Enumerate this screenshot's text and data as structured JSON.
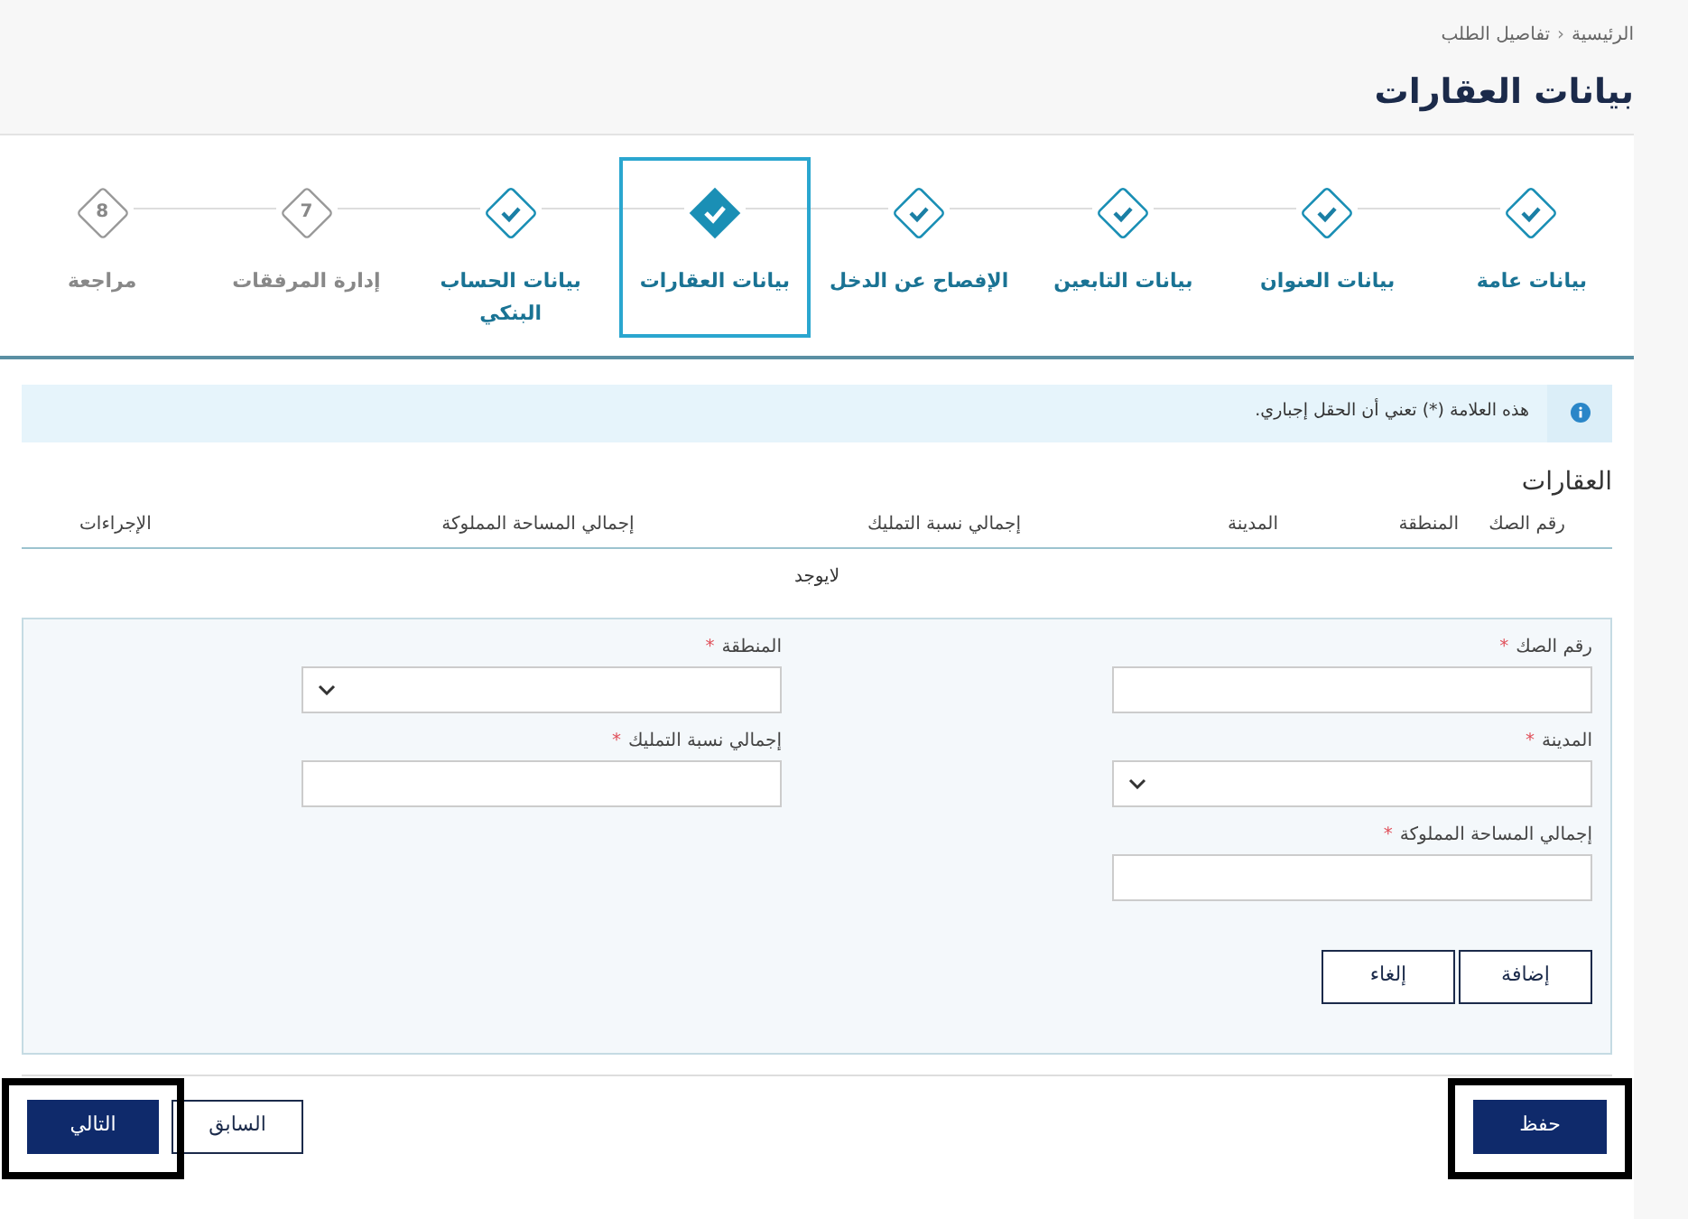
{
  "breadcrumb": [
    {
      "label": "الرئيسية"
    },
    {
      "label": "تفاصيل الطلب"
    }
  ],
  "breadcrumb_separator": "‹",
  "page_title": "بيانات العقارات",
  "steps": [
    {
      "label": "بيانات عامة",
      "kind": "done",
      "selected": false
    },
    {
      "label": "بيانات العنوان",
      "kind": "done",
      "selected": false
    },
    {
      "label": "بيانات التابعين",
      "kind": "done",
      "selected": false
    },
    {
      "label": "الإفصاح عن الدخل",
      "kind": "done",
      "selected": false
    },
    {
      "label": "بيانات العقارات",
      "kind": "current",
      "selected": true
    },
    {
      "label": "بيانات الحساب البنكي",
      "kind": "done",
      "selected": false
    },
    {
      "label": "إدارة المرفقات",
      "kind": "pending",
      "number": "7",
      "selected": false
    },
    {
      "label": "مراجعة",
      "kind": "pending",
      "number": "8",
      "selected": false
    }
  ],
  "notice": "هذه العلامة (*) تعني أن الحقل إجباري.",
  "section_title": "العقارات",
  "table": {
    "columns": [
      "رقم الصك",
      "المنطقة",
      "المدينة",
      "إجمالي نسبة التمليك",
      "إجمالي المساحة المملوكة",
      "الإجراءات"
    ],
    "empty_text": "لايوجد"
  },
  "form": {
    "fields": [
      {
        "label": "رقم الصك",
        "kind": "text",
        "required": true
      },
      {
        "label": "المنطقة",
        "kind": "select",
        "required": true
      },
      {
        "label": "المدينة",
        "kind": "select",
        "required": true
      },
      {
        "label": "إجمالي نسبة التمليك",
        "kind": "text",
        "required": true
      },
      {
        "label": "إجمالي المساحة المملوكة",
        "kind": "text",
        "required": true
      }
    ],
    "required_mark": "*",
    "buttons": [
      "إضافة",
      "إلغاء"
    ]
  },
  "footer": {
    "save": {
      "label": "حفظ",
      "highlighted": true
    },
    "next": {
      "label": "التالي",
      "highlighted": true
    },
    "previous": {
      "label": "السابق",
      "highlighted": false
    }
  }
}
